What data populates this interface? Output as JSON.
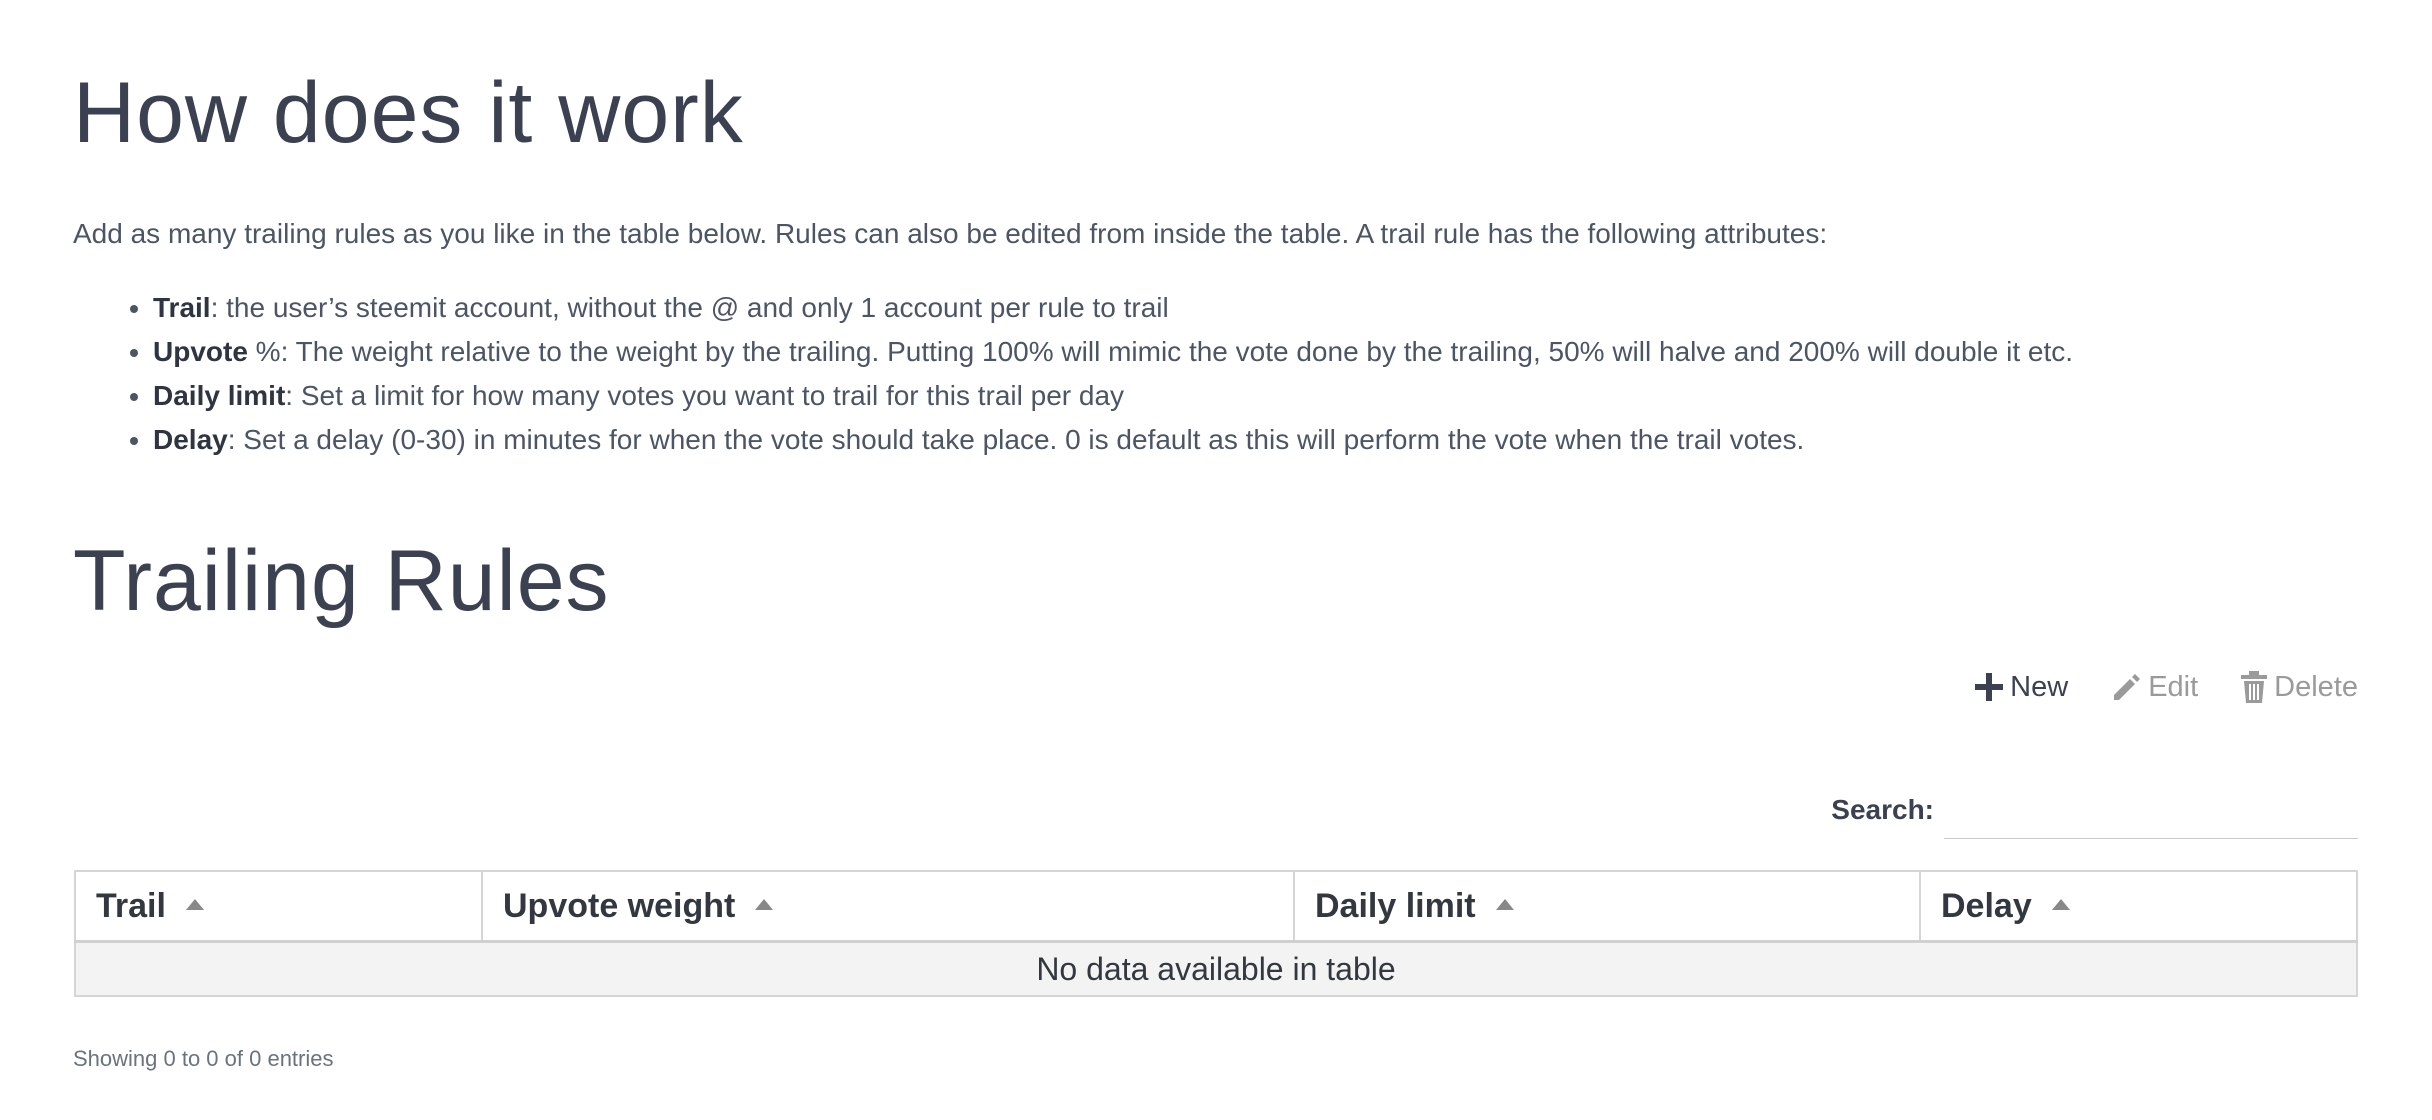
{
  "sections": {
    "how_title": "How does it work",
    "intro": "Add as many trailing rules as you like in the table below. Rules can also be edited from inside the table. A trail rule has the following attributes:",
    "attributes": [
      {
        "name": "Trail",
        "desc": ": the user’s steemit account, without the @ and only 1 account per rule to trail"
      },
      {
        "name": "Upvote",
        "desc": " %: The weight relative to the weight by the trailing. Putting 100% will mimic the vote done by the trailing, 50% will halve and 200% will double it etc."
      },
      {
        "name": "Daily limit",
        "desc": ": Set a limit for how many votes you want to trail for this trail per day"
      },
      {
        "name": "Delay",
        "desc": ": Set a delay (0-30) in minutes for when the vote should take place. 0 is default as this will perform the vote when the trail votes."
      }
    ],
    "rules_title": "Trailing Rules"
  },
  "toolbar": {
    "new_label": "New",
    "edit_label": "Edit",
    "delete_label": "Delete",
    "new_icon": "plus-icon",
    "edit_icon": "pencil-icon",
    "delete_icon": "trash-icon"
  },
  "search": {
    "label": "Search:",
    "value": "",
    "placeholder": ""
  },
  "table": {
    "columns": [
      "Trail",
      "Upvote weight",
      "Daily limit",
      "Delay"
    ],
    "empty_message": "No data available in table",
    "info": "Showing 0 to 0 of 0 entries"
  },
  "colors": {
    "text": "#3b4151",
    "disabled": "#9a9a9a",
    "empty_row_bg": "#f3f3f3"
  }
}
